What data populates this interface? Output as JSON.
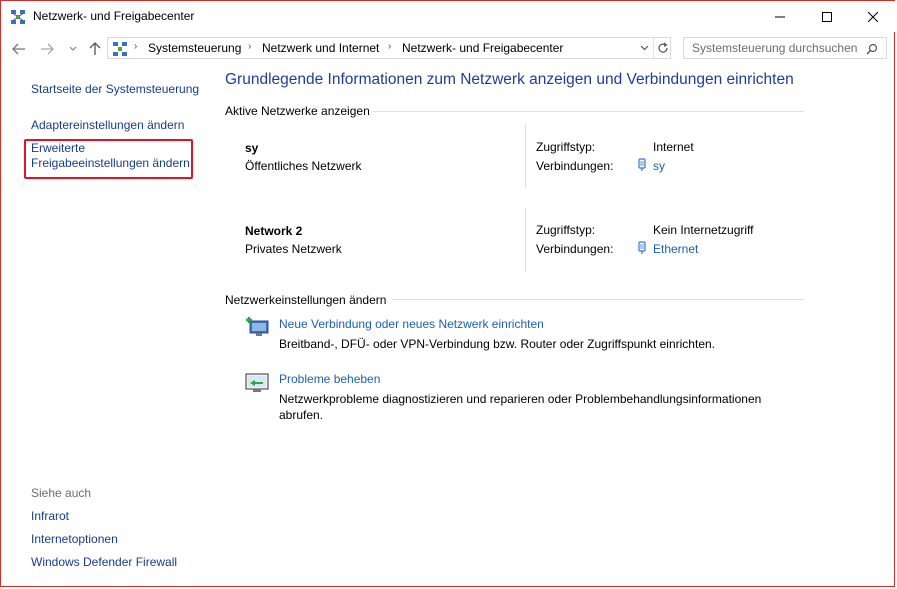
{
  "window": {
    "title": "Netzwerk- und Freigabecenter"
  },
  "address_bar": {
    "segments": [
      "Systemsteuerung",
      "Netzwerk und Internet",
      "Netzwerk- und Freigabecenter"
    ]
  },
  "search": {
    "placeholder": "Systemsteuerung durchsuchen"
  },
  "left_pane": {
    "links": [
      "Startseite der Systemsteuerung",
      "Adaptereinstellungen ändern",
      "Erweiterte",
      "Freigabeeinstellungen ändern"
    ],
    "see_also_label": "Siehe auch",
    "see_also": [
      "Infrarot",
      "Internetoptionen",
      "Windows Defender Firewall"
    ]
  },
  "main": {
    "title": "Grundlegende Informationen zum Netzwerk anzeigen und Verbindungen einrichten",
    "active_networks_header": "Aktive Netzwerke anzeigen",
    "networks": [
      {
        "name": "sy",
        "type": "Öffentliches Netzwerk",
        "access_label": "Zugriffstyp:",
        "access_value": "Internet",
        "connections_label": "Verbindungen:",
        "connection": "sy"
      },
      {
        "name": "Network  2",
        "type": "Privates Netzwerk",
        "access_label": "Zugriffstyp:",
        "access_value": "Kein Internetzugriff",
        "connections_label": "Verbindungen:",
        "connection": "Ethernet"
      }
    ],
    "settings_header": "Netzwerkeinstellungen ändern",
    "tasks": [
      {
        "link": "Neue Verbindung oder neues Netzwerk einrichten",
        "description": "Breitband-, DFÜ- oder VPN-Verbindung bzw. Router oder Zugriffspunkt einrichten.",
        "icon": "new-connection-icon"
      },
      {
        "link": "Probleme beheben",
        "description": "Netzwerkprobleme diagnostizieren und reparieren oder Problembehandlungsinformationen abrufen.",
        "icon": "troubleshoot-icon"
      }
    ]
  },
  "colors": {
    "link": "#1c5fb4",
    "title": "#1f3d99",
    "highlight": "#e81123"
  }
}
